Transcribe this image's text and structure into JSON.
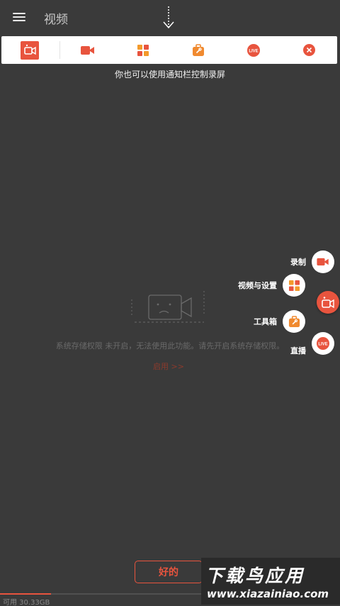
{
  "appbar": {
    "title": "视频"
  },
  "toolbar": {
    "items": [
      {
        "name": "record-floating",
        "icon": "camera-icon"
      },
      {
        "name": "record",
        "icon": "video-camera-icon"
      },
      {
        "name": "videos-settings",
        "icon": "grid-icon"
      },
      {
        "name": "toolbox",
        "icon": "toolbox-icon"
      },
      {
        "name": "live",
        "icon": "live-icon",
        "text": "LIVE"
      },
      {
        "name": "close",
        "icon": "close-icon"
      }
    ]
  },
  "hint": {
    "text": "你也可以使用通知栏控制录屏"
  },
  "empty": {
    "message": "系统存储权限 未开启，无法使用此功能。请先开启系统存储权限。",
    "enable_link": "启用 >>"
  },
  "fab_menu": {
    "record": "录制",
    "videos_settings": "视频与设置",
    "toolbox": "工具箱",
    "live": "直播",
    "live_icon_text": "LIVE"
  },
  "ok_button": {
    "label": "好的"
  },
  "storage": {
    "text": "可用 30.33GB",
    "used_fraction": 0.15
  },
  "watermark": {
    "title": "下载鸟应用",
    "url": "www.xiazainiao.com"
  },
  "colors": {
    "accent": "#e8543e",
    "background": "#3a3a3a",
    "toolbar": "#ffffff"
  }
}
